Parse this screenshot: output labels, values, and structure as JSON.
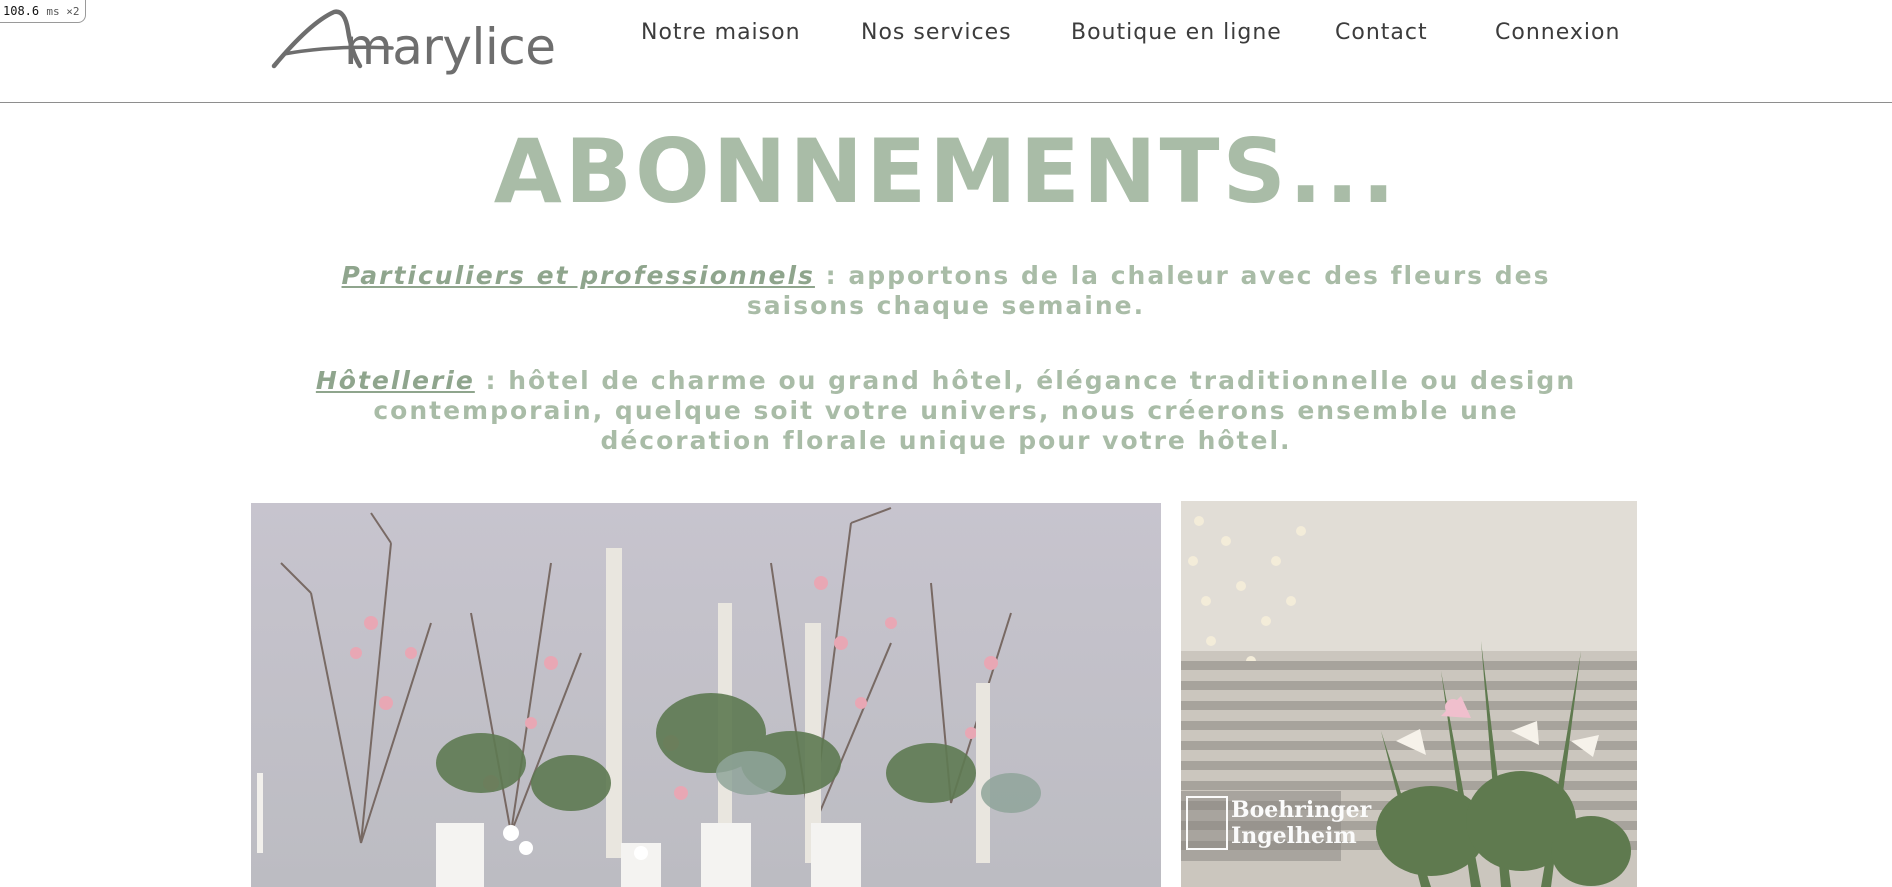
{
  "perf": {
    "value": "108.6",
    "unit": "ms ×2"
  },
  "brand": {
    "logo_text": "Amarylice",
    "logo_rest": "marylice",
    "logo_initial": "A"
  },
  "nav": {
    "items": [
      {
        "label": "Notre maison"
      },
      {
        "label": "Nos services"
      },
      {
        "label": "Boutique en ligne"
      },
      {
        "label": "Contact"
      },
      {
        "label": "Connexion"
      }
    ]
  },
  "page": {
    "title": "ABONNEMENTS...",
    "paragraphs": [
      {
        "lead": "Particuliers et professionnels",
        "text": " : apportons de la chaleur avec des fleurs des saisons chaque semaine."
      },
      {
        "lead": "Hôtellerie",
        "text": " : hôtel de charme ou grand hôtel, élégance traditionnelle ou design contemporain, quelque soit votre univers, nous créerons ensemble une décoration florale unique pour votre hôtel."
      }
    ]
  },
  "photos": {
    "right_sign": {
      "line1": "Boehringer",
      "line2": "Ingelheim"
    }
  },
  "colors": {
    "accent": "#a9bca7",
    "nav_text": "#3c3c3c",
    "logo": "#6e6e6e"
  }
}
